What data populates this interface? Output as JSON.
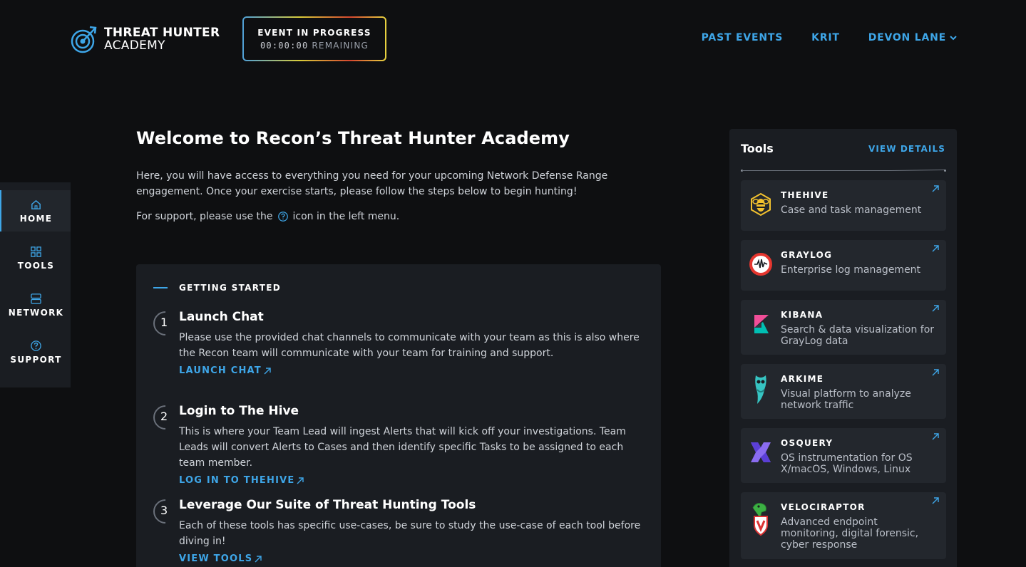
{
  "brand": {
    "line1": "THREAT HUNTER",
    "line2": "ACADEMY"
  },
  "event": {
    "title": "EVENT IN PROGRESS",
    "time": "00:00:00",
    "remaining": "REMAINING"
  },
  "nav": {
    "past_events": "PAST EVENTS",
    "krit": "KRIT",
    "user": "DEVON LANE"
  },
  "sidebar": {
    "items": [
      {
        "label": "HOME",
        "icon": "home-icon",
        "active": true
      },
      {
        "label": "TOOLS",
        "icon": "grid-icon"
      },
      {
        "label": "NETWORK",
        "icon": "server-icon"
      },
      {
        "label": "SUPPORT",
        "icon": "help-icon"
      }
    ]
  },
  "main": {
    "title": "Welcome to Recon’s Threat Hunter Academy",
    "intro": "Here, you will have access to everything you need for your upcoming Network Defense Range engagement. Once your exercise starts, please follow the steps below to begin hunting!",
    "support_prefix": "For support, please use the",
    "support_suffix": "icon in the left menu."
  },
  "getting_started": {
    "heading": "GETTING STARTED",
    "steps": [
      {
        "num": "1",
        "title": "Launch Chat",
        "desc": "Please use the provided chat channels to communicate with your team as this is also where the Recon team will communicate with your team for training and support.",
        "link": "LAUNCH CHAT"
      },
      {
        "num": "2",
        "title": "Login to The Hive",
        "desc": "This is where your Team Lead will ingest Alerts that will kick off your investigations. Team Leads will convert Alerts to Cases and then identify specific Tasks to be assigned to each team member.",
        "link": "LOG IN TO THEHIVE"
      },
      {
        "num": "3",
        "title": "Leverage Our Suite of Threat Hunting Tools",
        "desc": "Each of these tools has specific use-cases, be sure to study the use-case of each tool before diving in!",
        "link": "VIEW TOOLS"
      }
    ]
  },
  "tools": {
    "title": "Tools",
    "view_details": "VIEW DETAILS",
    "items": [
      {
        "name": "THEHIVE",
        "desc": "Case and task management",
        "icon": "bee-icon"
      },
      {
        "name": "GRAYLOG",
        "desc": "Enterprise log management",
        "icon": "graylog-icon"
      },
      {
        "name": "KIBANA",
        "desc": "Search & data visualization for GrayLog data",
        "icon": "kibana-icon"
      },
      {
        "name": "ARKIME",
        "desc": "Visual platform to analyze network traffic",
        "icon": "owl-icon"
      },
      {
        "name": "OSQUERY",
        "desc": "OS instrumentation for OS X/macOS, Windows, Linux",
        "icon": "osquery-icon"
      },
      {
        "name": "VELOCIRAPTOR",
        "desc": "Advanced endpoint monitoring, digital forensic, cyber response",
        "icon": "raptor-icon"
      }
    ]
  },
  "colors": {
    "accent": "#3ea6e8",
    "bg": "#0e0f11",
    "panel": "#1a1d22",
    "card": "#23272d"
  }
}
